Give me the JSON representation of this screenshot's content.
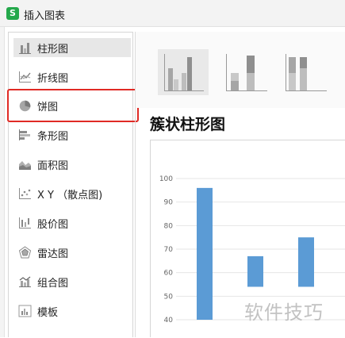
{
  "window": {
    "title": "插入图表",
    "app_icon_letter": "S",
    "app_icon_color": "#24a84b"
  },
  "sidebar": {
    "items": [
      {
        "label": "柱形图",
        "icon": "column-chart-icon",
        "selected": true
      },
      {
        "label": "折线图",
        "icon": "line-chart-icon"
      },
      {
        "label": "饼图",
        "icon": "pie-chart-icon",
        "highlighted": true
      },
      {
        "label": "条形图",
        "icon": "bar-chart-icon"
      },
      {
        "label": "面积图",
        "icon": "area-chart-icon"
      },
      {
        "label": "X Y （散点图)",
        "icon": "scatter-chart-icon"
      },
      {
        "label": "股价图",
        "icon": "stock-chart-icon"
      },
      {
        "label": "雷达图",
        "icon": "radar-chart-icon"
      },
      {
        "label": "组合图",
        "icon": "combo-chart-icon"
      },
      {
        "label": "模板",
        "icon": "template-icon"
      }
    ]
  },
  "subtypes": [
    {
      "icon": "clustered-column-icon",
      "selected": true
    },
    {
      "icon": "stacked-column-icon"
    },
    {
      "icon": "percent-stacked-column-icon"
    }
  ],
  "preview": {
    "heading": "簇状柱形图"
  },
  "chart_data": {
    "type": "bar",
    "title": "",
    "ylabel": "",
    "xlabel": "",
    "ylim": [
      40,
      100
    ],
    "yticks": [
      100,
      90,
      80,
      70,
      60,
      50,
      40
    ],
    "series": [
      {
        "name": "",
        "values": [
          96,
          67,
          75
        ],
        "bases": [
          40,
          54,
          54
        ]
      }
    ],
    "bar_color": "#5b9bd5",
    "grid": true
  },
  "watermark": {
    "text": "软件技巧"
  },
  "colors": {
    "highlight": "#e02a25",
    "accent": "#5b9bd5"
  }
}
